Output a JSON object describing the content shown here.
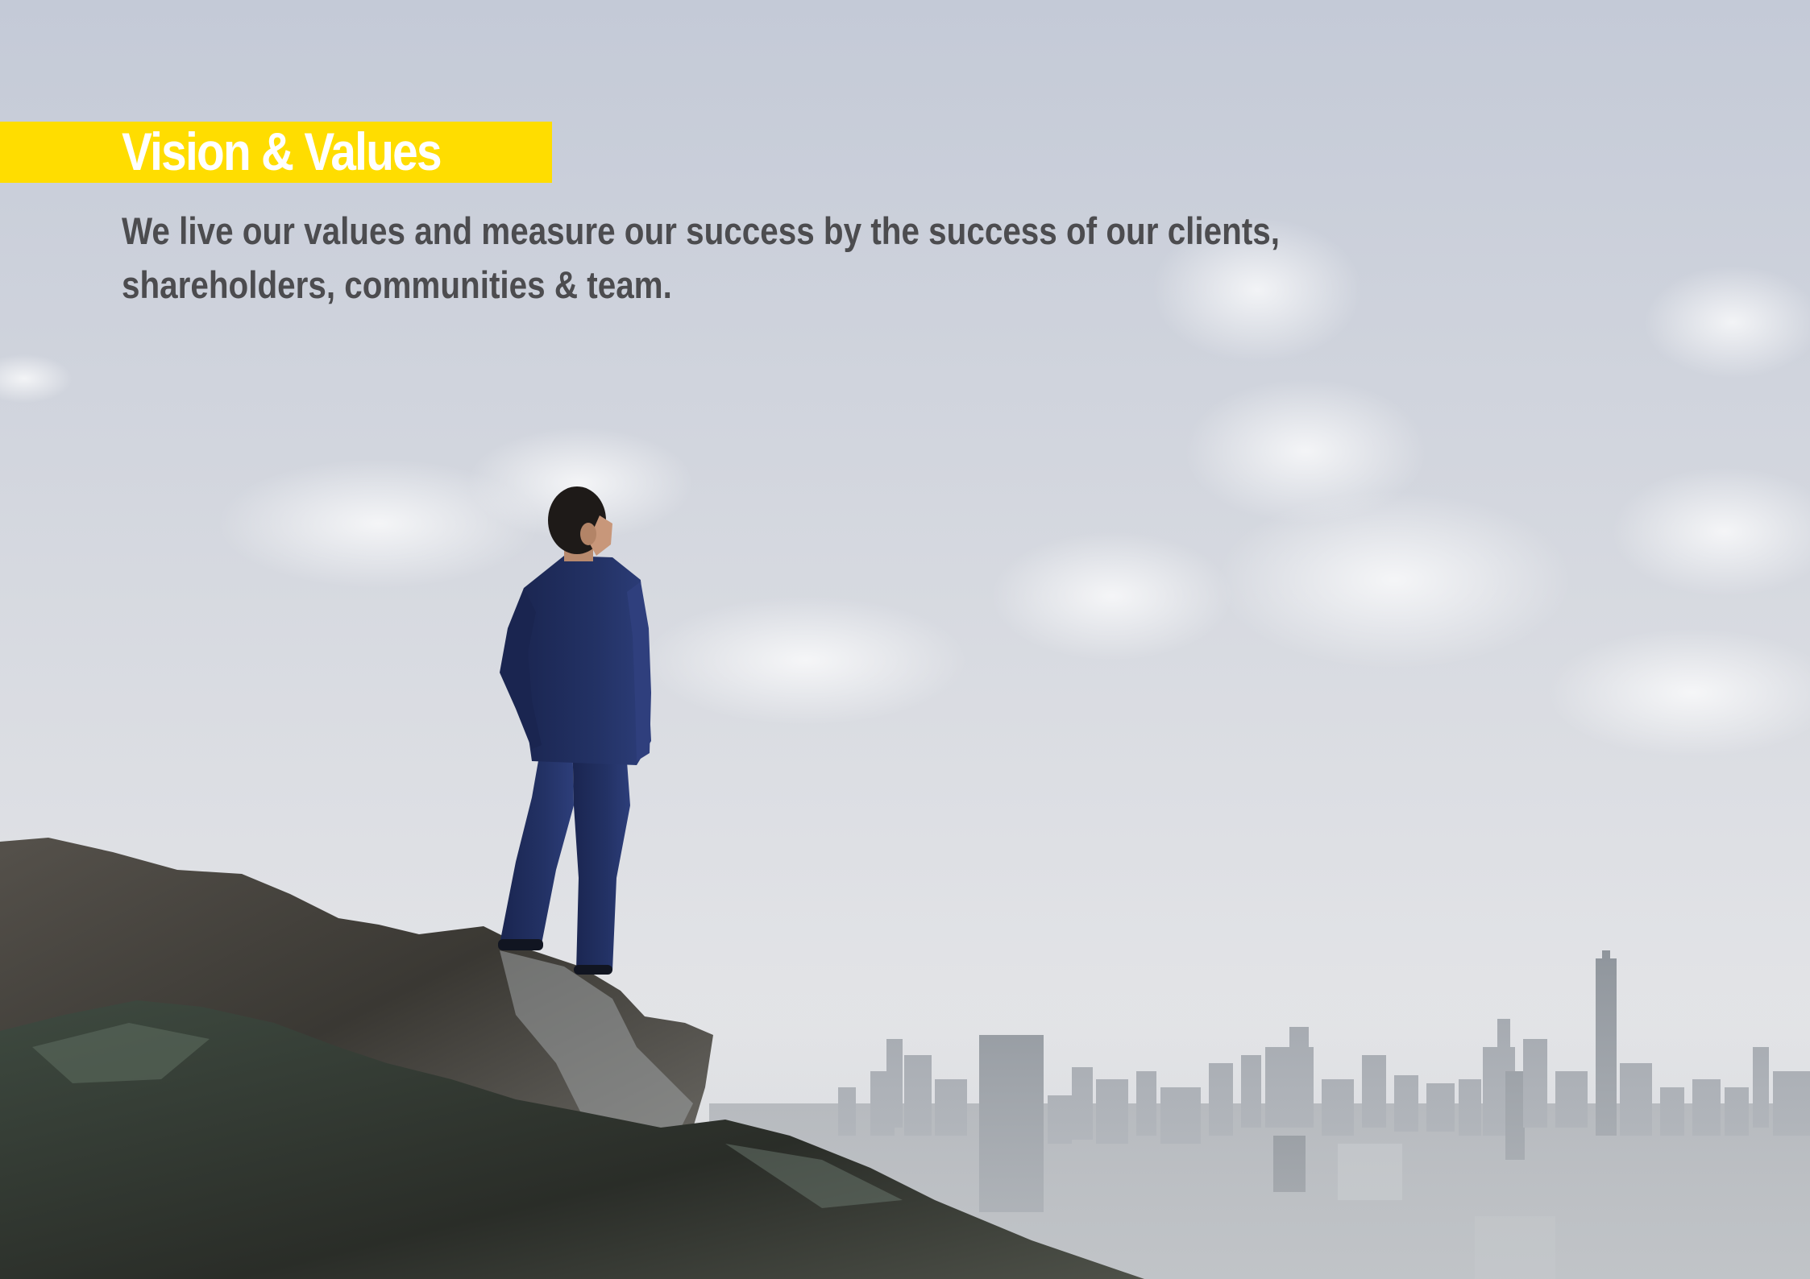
{
  "page": {
    "title": "Vision & Values",
    "subtitle": "We live our values and measure our success by the success of our clients, shareholders, communities & team."
  },
  "colors": {
    "accent_yellow": "#FFDD00",
    "title_text": "#FFFFFF",
    "body_text": "#4C4C4F",
    "sky_top": "#C3C9D6",
    "sky_bottom": "#E2E4E8",
    "suit": "#1F2C5A",
    "rock": "#3E3B37"
  },
  "scene": {
    "description_icons": [
      "person-standing-icon",
      "city-skyline-icon",
      "rock-cliff-icon",
      "cloud-icon"
    ]
  }
}
